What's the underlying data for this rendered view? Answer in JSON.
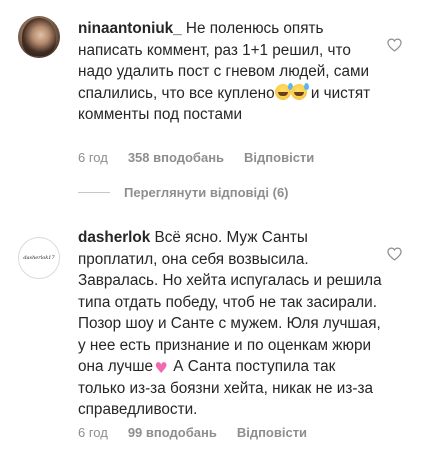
{
  "comments": [
    {
      "username": "ninaantoniuk_",
      "text_part1": " Не поленюсь опять написать коммент, раз 1+1 решил, что надо удалить пост с гневом людей, сами спалились, что все куплено",
      "emoji_1": "sweat-smile-emoji",
      "emoji_2": "sweat-smile-emoji",
      "text_part2": " и чистят комменты под постами",
      "time": "6 год",
      "likes": "358 вподобань",
      "reply_label": "Відповісти"
    },
    {
      "username": "dasherlok",
      "avatar_text": "dasherlok17",
      "text_part1": " Всё ясно. Муж Санты проплатил, она себя возвысила. Завралась. Но хейта испугалась и решила типа отдать победу, чтоб не так засирали. Позор шоу и Санте с мужем. Юля лучшая, у нее есть признание и по оценкам жюри она лучше",
      "emoji_1": "pink-heart-emoji",
      "text_part2": " А Санта поступила так только из-за боязни хейта, никак не из-за справедливости.",
      "time": "6 год",
      "likes": "99 вподобань",
      "reply_label": "Відповісти"
    }
  ],
  "view_replies": "Переглянути відповіді (6)",
  "colors": {
    "text": "#262626",
    "secondary": "#8e8e8e",
    "heart_outline": "#8e8e8e"
  }
}
